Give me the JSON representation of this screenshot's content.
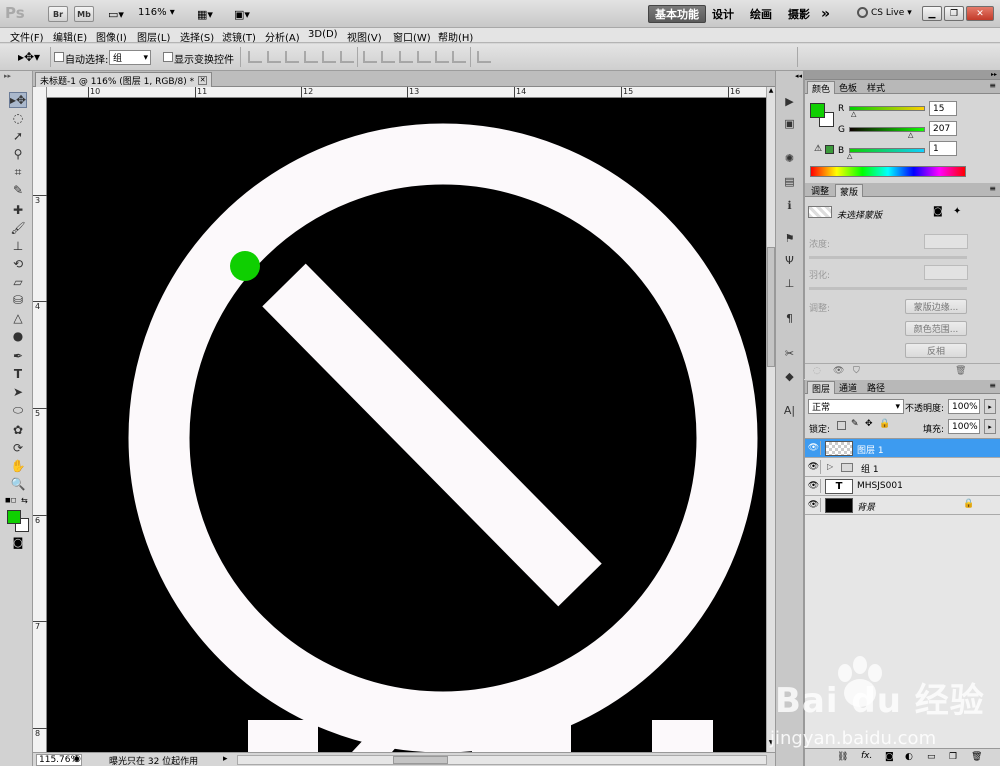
{
  "app": {
    "logo": "Ps",
    "br_label": "Br",
    "mb_label": "Mb",
    "zoom": "116%",
    "workspaces": [
      "基本功能",
      "设计",
      "绘画",
      "摄影"
    ],
    "more": "»",
    "cs_live": "CS Live"
  },
  "menu": [
    "文件(F)",
    "编辑(E)",
    "图像(I)",
    "图层(L)",
    "选择(S)",
    "滤镜(T)",
    "分析(A)",
    "3D(D)",
    "视图(V)",
    "窗口(W)",
    "帮助(H)"
  ],
  "options": {
    "auto_select_label": "自动选择:",
    "auto_select_value": "组",
    "show_transform_label": "显示变换控件"
  },
  "document": {
    "tab_title": "未标题-1 @ 116% (图层 1, RGB/8) *",
    "ruler_top": [
      "10",
      "11",
      "12",
      "13",
      "14",
      "15",
      "16"
    ],
    "ruler_left": [
      "3",
      "4",
      "5",
      "6",
      "7",
      "8"
    ],
    "status_zoom": "115.76%",
    "status_text": "曝光只在 32 位起作用"
  },
  "watermark": {
    "brand": "Bai du 经验",
    "url": "jingyan.baidu.com"
  },
  "color_panel": {
    "tabs": [
      "颜色",
      "色板",
      "样式"
    ],
    "fg_color": "#0fcf01",
    "r_label": "R",
    "r_value": "15",
    "g_label": "G",
    "g_value": "207",
    "b_label": "B",
    "b_value": "1"
  },
  "adjust_panel": {
    "tabs": [
      "调整",
      "蒙版"
    ],
    "no_mask": "未选择蒙版",
    "density_label": "浓度:",
    "feather_label": "羽化:",
    "refine_label": "调整:",
    "mask_edge": "蒙版边缘...",
    "color_range": "颜色范围...",
    "invert": "反相"
  },
  "layers_panel": {
    "tabs": [
      "图层",
      "通道",
      "路径"
    ],
    "blend_mode": "正常",
    "opacity_label": "不透明度:",
    "opacity_value": "100%",
    "lock_label": "锁定:",
    "fill_label": "填充:",
    "fill_value": "100%",
    "layers": [
      {
        "name": "图层 1",
        "selected": true
      },
      {
        "name": "组 1",
        "selected": false
      },
      {
        "name": "MHSJS001",
        "selected": false
      },
      {
        "name": "背景",
        "selected": false
      }
    ]
  }
}
